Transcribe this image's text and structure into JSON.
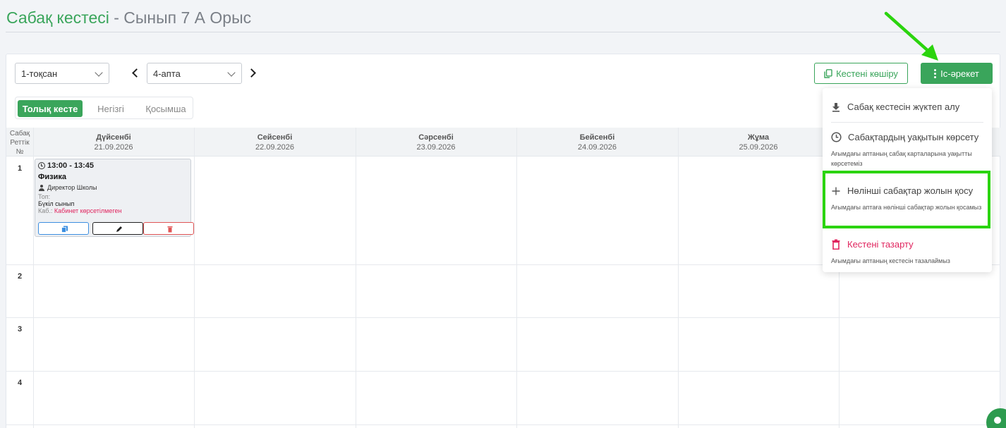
{
  "page": {
    "title_main": "Сабақ кестесі",
    "title_rest": " - Сынып 7 А Орыс"
  },
  "filters": {
    "quarter": "1-тоқсан",
    "week": "4-апта"
  },
  "toolbar": {
    "copy_label": "Кестені көшіру",
    "action_label": "Іс-әрекет"
  },
  "tabs": [
    {
      "label": "Толық кесте",
      "active": true
    },
    {
      "label": "Негізгі",
      "active": false
    },
    {
      "label": "Қосымша",
      "active": false
    }
  ],
  "grid": {
    "corner_label": "Сабақ Реттік №",
    "days": [
      {
        "name": "Дүйсенбі",
        "date": "21.09.2026"
      },
      {
        "name": "Сейсенбі",
        "date": "22.09.2026"
      },
      {
        "name": "Сәрсенбі",
        "date": "23.09.2026"
      },
      {
        "name": "Бейсенбі",
        "date": "24.09.2026"
      },
      {
        "name": "Жұма",
        "date": "25.09.2026"
      }
    ],
    "rows": [
      "1",
      "2",
      "3",
      "4"
    ]
  },
  "lesson": {
    "time": "13:00 - 13:45",
    "subject": "Физика",
    "teacher": "Директор Школы",
    "group_label": "Топ:",
    "group_value": "Бүкіл сынып",
    "room_label": "Каб.:",
    "room_value": "Кабинет көрсетілмеген"
  },
  "menu": {
    "download": {
      "label": "Сабақ кестесін жүктеп алу"
    },
    "show_time": {
      "label": "Сабақтардың уақытын көрсету",
      "desc": "Ағымдағы аптаның сабақ карталарына уақытты көрсетеміз"
    },
    "add_zero": {
      "label": "Нөлінші сабақтар жолын қосу",
      "desc": "Ағымдағы аптаға нөлінші сабақтар жолын қосамыз"
    },
    "clear": {
      "label": "Кестені тазарту",
      "desc": "Ағымдағы аптаның кестесін тазалаймыз"
    }
  },
  "colors": {
    "brand_green": "#3aa55b",
    "danger": "#e0245e",
    "highlight": "#2bd40e"
  }
}
